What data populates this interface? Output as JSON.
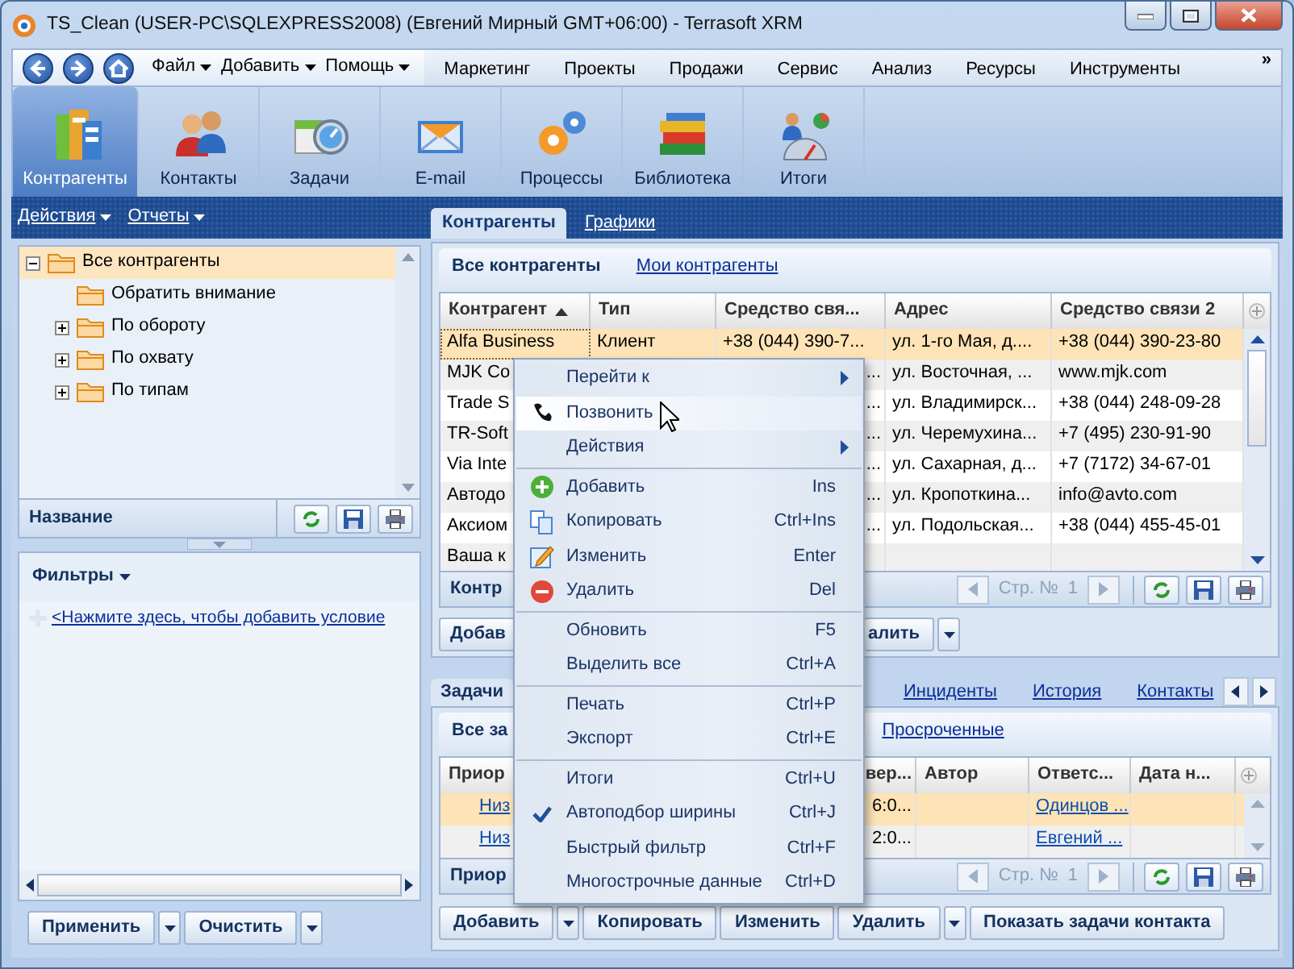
{
  "window": {
    "title": "TS_Clean (USER-PC\\SQLEXPRESS2008) (Евгений Мирный GMT+06:00) - Terrasoft XRM"
  },
  "menu_bar": {
    "menus": [
      "Файл",
      "Добавить",
      "Помощь"
    ],
    "sections": [
      "Маркетинг",
      "Проекты",
      "Продажи",
      "Сервис",
      "Анализ",
      "Ресурсы",
      "Инструменты"
    ],
    "more": "»"
  },
  "modules": [
    {
      "label": "Контрагенты",
      "selected": true
    },
    {
      "label": "Контакты",
      "selected": false
    },
    {
      "label": "Задачи",
      "selected": false
    },
    {
      "label": "E-mail",
      "selected": false
    },
    {
      "label": "Процессы",
      "selected": false
    },
    {
      "label": "Библиотека",
      "selected": false
    },
    {
      "label": "Итоги",
      "selected": false
    }
  ],
  "sidebar": {
    "menus": [
      "Действия",
      "Отчеты"
    ],
    "tree": [
      {
        "label": "Все контрагенты",
        "expanded": true,
        "selected": true,
        "children": [
          {
            "label": "Обратить внимание",
            "selected": false
          },
          {
            "label": "По обороту",
            "expanded": false,
            "selected": false
          },
          {
            "label": "По охвату",
            "expanded": false,
            "selected": false
          },
          {
            "label": "По типам",
            "expanded": false,
            "selected": false
          }
        ]
      }
    ],
    "tree_footer": "Название",
    "filters": {
      "title": "Фильтры",
      "add_link": "<Нажмите здесь, чтобы добавить условие"
    },
    "buttons": [
      "Применить",
      "Очистить"
    ]
  },
  "main_tabs": [
    {
      "label": "Контрагенты",
      "selected": true
    },
    {
      "label": "Графики",
      "selected": false
    }
  ],
  "accounts": {
    "views": [
      {
        "label": "Все контрагенты",
        "selected": true
      },
      {
        "label": "Мои контрагенты",
        "selected": false
      }
    ],
    "columns": [
      {
        "label": "Контрагент",
        "sort_ascending": true
      },
      {
        "label": "Тип"
      },
      {
        "label": "Средство свя..."
      },
      {
        "label": "Адрес"
      },
      {
        "label": "Средство связи 2"
      }
    ],
    "rows": [
      {
        "selected": true,
        "cells": [
          "Alfa Business",
          "Клиент",
          "+38 (044) 390-7...",
          "ул. 1-го Мая, д....",
          "+38 (044) 390-23-80"
        ]
      },
      {
        "selected": false,
        "cells": [
          "MJK Co",
          null,
          "...",
          "ул. Восточная, ...",
          "www.mjk.com"
        ]
      },
      {
        "selected": false,
        "cells": [
          "Trade S",
          null,
          "...",
          "ул. Владимирск...",
          "+38 (044) 248-09-28"
        ]
      },
      {
        "selected": false,
        "cells": [
          "TR-Soft",
          null,
          "...",
          "ул. Черемухина...",
          "+7 (495) 230-91-90"
        ]
      },
      {
        "selected": false,
        "cells": [
          "Via Inte",
          null,
          "...",
          "ул. Сахарная, д...",
          "+7 (7172) 34-67-01"
        ]
      },
      {
        "selected": false,
        "cells": [
          "Автодо",
          null,
          "...",
          "ул. Кропоткина...",
          "info@avto.com"
        ]
      },
      {
        "selected": false,
        "cells": [
          "Аксиом",
          null,
          "...",
          "ул. Подольская...",
          "+38 (044) 455-45-01"
        ]
      },
      {
        "selected": false,
        "cells": [
          "Ваша к"
        ]
      }
    ],
    "footer": "Контр",
    "page_label": "Стр. №",
    "page": "1",
    "buttons": [
      "Добав",
      "алить"
    ]
  },
  "detail_tabs": [
    {
      "label": "Задачи",
      "selected": true
    },
    {
      "label": "Инциденты",
      "selected": false
    },
    {
      "label": "История",
      "selected": false
    },
    {
      "label": "Контакты",
      "selected": false
    }
  ],
  "tasks": {
    "views": [
      {
        "label": "Все за",
        "selected": true
      },
      {
        "label": "Просроченные",
        "selected": false
      }
    ],
    "columns": [
      "Приор",
      "вер...",
      "Автор",
      "Ответс...",
      "Дата н..."
    ],
    "rows": [
      {
        "selected": true,
        "priority": "Низ",
        "column_3": "6:0...",
        "responsible": "Одинцов ..."
      },
      {
        "selected": false,
        "priority": "Низ",
        "column_3": "2:0...",
        "responsible": "Евгений ..."
      }
    ],
    "footer": "Приор",
    "page_label": "Стр. №",
    "page": "1",
    "buttons": [
      "Добавить",
      "Копировать",
      "Изменить",
      "Удалить",
      "Показать задачи контакта"
    ]
  },
  "context_menu": {
    "groups": [
      [
        {
          "label": "Перейти к",
          "submenu": true,
          "highlighted": false
        },
        {
          "label": "Позвонить",
          "highlighted": true
        },
        {
          "label": "Действия",
          "submenu": true,
          "highlighted": false
        }
      ],
      [
        {
          "label": "Добавить",
          "shortcut": "Ins",
          "highlighted": false
        },
        {
          "label": "Копировать",
          "shortcut": "Ctrl+Ins",
          "highlighted": false
        },
        {
          "label": "Изменить",
          "shortcut": "Enter",
          "highlighted": false
        },
        {
          "label": "Удалить",
          "shortcut": "Del",
          "highlighted": false
        }
      ],
      [
        {
          "label": "Обновить",
          "shortcut": "F5",
          "highlighted": false
        },
        {
          "label": "Выделить все",
          "shortcut": "Ctrl+A",
          "highlighted": false
        }
      ],
      [
        {
          "label": "Печать",
          "shortcut": "Ctrl+P",
          "highlighted": false
        },
        {
          "label": "Экспорт",
          "shortcut": "Ctrl+E",
          "highlighted": false
        }
      ],
      [
        {
          "label": "Итоги",
          "shortcut": "Ctrl+U",
          "checked": false,
          "highlighted": false
        },
        {
          "label": "Автоподбор ширины",
          "shortcut": "Ctrl+J",
          "checked": true,
          "highlighted": false
        },
        {
          "label": "Быстрый фильтр",
          "shortcut": "Ctrl+F",
          "checked": false,
          "highlighted": false
        },
        {
          "label": "Многострочные данные",
          "shortcut": "Ctrl+D",
          "checked": false,
          "highlighted": false
        }
      ]
    ]
  }
}
